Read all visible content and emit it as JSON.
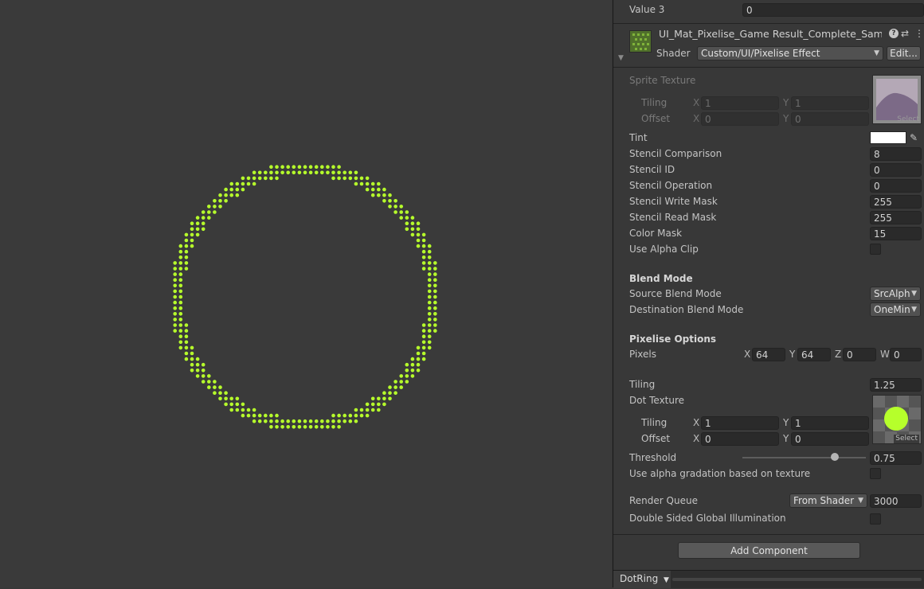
{
  "scene": {
    "dot_color": "#b6ff2b",
    "background": "#3a3a3a"
  },
  "inspector": {
    "value3": {
      "label": "Value 3",
      "value": "0"
    },
    "material": {
      "name": "UI_Mat_Pixelise_Game Result_Complete_Sam",
      "shader_label": "Shader",
      "shader_value": "Custom/UI/Pixelise Effect",
      "edit_label": "Edit...",
      "help_icon": "help-icon",
      "preset_icon": "preset-icon",
      "menu_icon": "kebab-menu-icon"
    },
    "sprite_texture": {
      "label": "Sprite Texture",
      "tiling_label": "Tiling",
      "offset_label": "Offset",
      "tiling_x": "1",
      "tiling_y": "1",
      "offset_x": "0",
      "offset_y": "0",
      "x_label": "X",
      "y_label": "Y",
      "select_label": "Select"
    },
    "tint_label": "Tint",
    "props": [
      {
        "label": "Stencil Comparison",
        "value": "8"
      },
      {
        "label": "Stencil ID",
        "value": "0"
      },
      {
        "label": "Stencil Operation",
        "value": "0"
      },
      {
        "label": "Stencil Write Mask",
        "value": "255"
      },
      {
        "label": "Stencil Read Mask",
        "value": "255"
      },
      {
        "label": "Color Mask",
        "value": "15"
      }
    ],
    "use_alpha_clip": "Use Alpha Clip",
    "blend": {
      "header": "Blend Mode",
      "source_label": "Source Blend Mode",
      "source_value": "SrcAlph",
      "dest_label": "Destination Blend Mode",
      "dest_value": "OneMin"
    },
    "pixelise": {
      "header": "Pixelise Options",
      "pixels_label": "Pixels",
      "x_label": "X",
      "x": "64",
      "y_label": "Y",
      "y": "64",
      "z_label": "Z",
      "z": "0",
      "w_label": "W",
      "w": "0"
    },
    "tiling": {
      "label": "Tiling",
      "value": "1.25"
    },
    "dot_texture": {
      "label": "Dot Texture",
      "tiling_label": "Tiling",
      "offset_label": "Offset",
      "tiling_x": "1",
      "tiling_y": "1",
      "offset_x": "0",
      "offset_y": "0",
      "x_label": "X",
      "y_label": "Y",
      "select_label": "Select"
    },
    "threshold": {
      "label": "Threshold",
      "value": "0.75",
      "fraction": 0.75
    },
    "alpha_gradation": "Use alpha gradation based on texture",
    "render_queue": {
      "label": "Render Queue",
      "mode": "From Shader",
      "value": "3000"
    },
    "double_sided": "Double Sided Global Illumination",
    "add_component": "Add Component",
    "footer": {
      "label": "DotRing"
    }
  }
}
